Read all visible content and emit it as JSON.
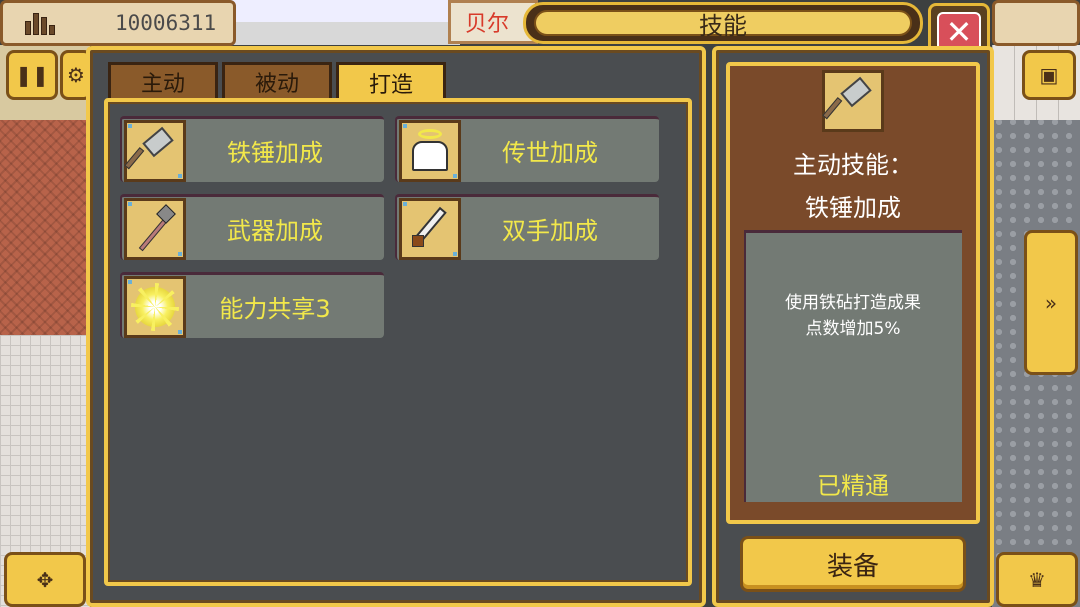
{
  "hud": {
    "coins": "10006311",
    "location": "贝尔",
    "title": "技能"
  },
  "tabs": [
    {
      "label": "主动",
      "active": false
    },
    {
      "label": "被动",
      "active": false
    },
    {
      "label": "打造",
      "active": true
    }
  ],
  "skills": [
    {
      "label": "铁锤加成",
      "icon": "hammer-icon"
    },
    {
      "label": "传世加成",
      "icon": "angel-icon"
    },
    {
      "label": "武器加成",
      "icon": "spear-icon"
    },
    {
      "label": "双手加成",
      "icon": "sword-icon"
    },
    {
      "label": "能力共享3",
      "icon": "starburst-icon"
    }
  ],
  "detail": {
    "type": "主动技能：",
    "name": "铁锤加成",
    "description_line1": "使用铁砧打造成果",
    "description_line2": "点数增加5%",
    "status": "已精通",
    "equip_label": "装备"
  },
  "colors": {
    "accent": "#f2c84a",
    "skill_text": "#f2e84a",
    "close": "#d84f5a"
  }
}
